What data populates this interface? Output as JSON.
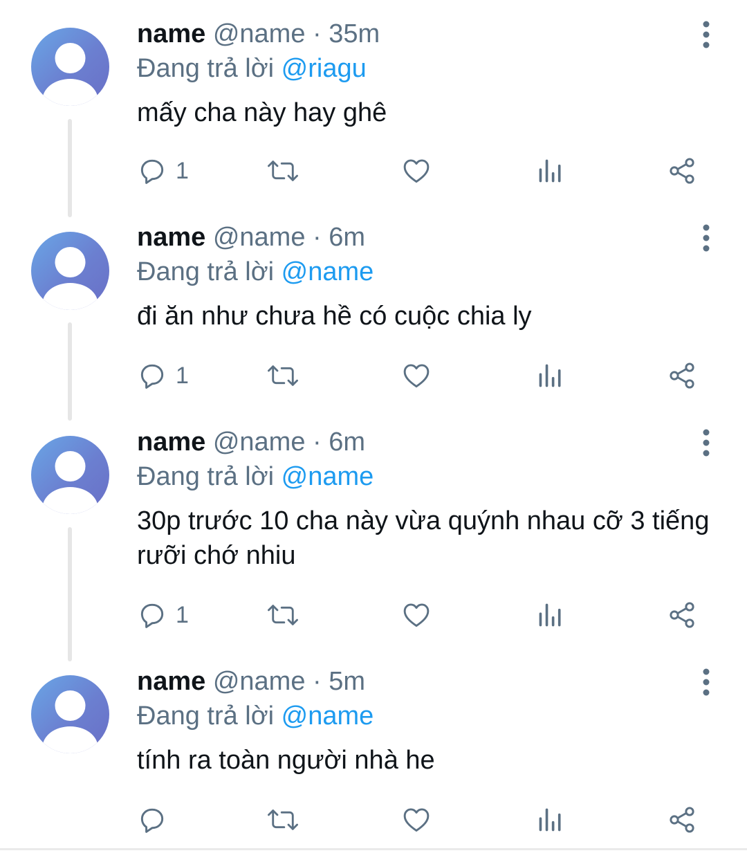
{
  "colors": {
    "text": "#0f1419",
    "secondary": "#5b7083",
    "link": "#1d9bf0",
    "thread_line": "#e6e6e6",
    "avatar_gradient": [
      "#6aa6e6",
      "#6a6fc6"
    ]
  },
  "tweets": [
    {
      "display_name": "name",
      "handle": "@name",
      "separator": "·",
      "time": "35m",
      "reply_prefix": "Đang trả lời",
      "reply_to": "@riagu",
      "text": "mấy cha này hay ghê",
      "reply_count": "1",
      "icons": [
        "reply-icon",
        "retweet-icon",
        "like-icon",
        "views-icon",
        "share-icon",
        "more-icon"
      ]
    },
    {
      "display_name": "name",
      "handle": "@name",
      "separator": "·",
      "time": "6m",
      "reply_prefix": "Đang trả lời",
      "reply_to": "@name",
      "text": "đi ăn như chưa hề có cuộc chia ly",
      "reply_count": "1"
    },
    {
      "display_name": "name",
      "handle": "@name",
      "separator": "·",
      "time": "6m",
      "reply_prefix": "Đang trả lời",
      "reply_to": "@name",
      "text": "30p trước 10 cha này vừa quýnh nhau cỡ 3 tiếng rưỡi chớ nhiu",
      "reply_count": "1"
    },
    {
      "display_name": "name",
      "handle": "@name",
      "separator": "·",
      "time": "5m",
      "reply_prefix": "Đang trả lời",
      "reply_to": "@name",
      "text": "tính ra toàn người nhà he",
      "reply_count": ""
    }
  ]
}
